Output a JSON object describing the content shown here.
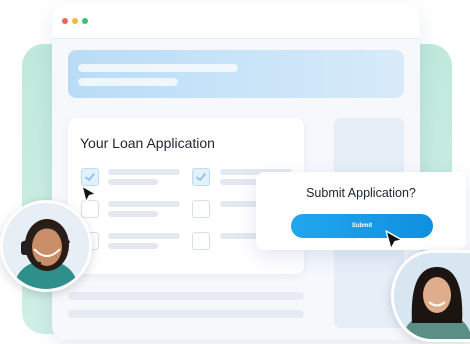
{
  "window": {
    "controls": [
      "close",
      "minimize",
      "maximize"
    ],
    "control_colors": [
      "#f26257",
      "#f6b93b",
      "#36c46a"
    ]
  },
  "form": {
    "title": "Your Loan Application",
    "checkboxes": [
      {
        "row": 1,
        "column": 1,
        "checked": true
      },
      {
        "row": 1,
        "column": 2,
        "checked": true
      },
      {
        "row": 2,
        "column": 1,
        "checked": false
      },
      {
        "row": 2,
        "column": 2,
        "checked": false
      },
      {
        "row": 3,
        "column": 1,
        "checked": false
      },
      {
        "row": 3,
        "column": 2,
        "checked": false
      }
    ]
  },
  "dialog": {
    "title": "Submit Application?",
    "submit_label": "Submit"
  },
  "colors": {
    "accent": "#1a9be8",
    "background_panel": "#c9ece1",
    "hero_banner": "#c6e3f8"
  },
  "icons": [
    "check-icon",
    "cursor-arrow-icon",
    "headset-icon"
  ]
}
